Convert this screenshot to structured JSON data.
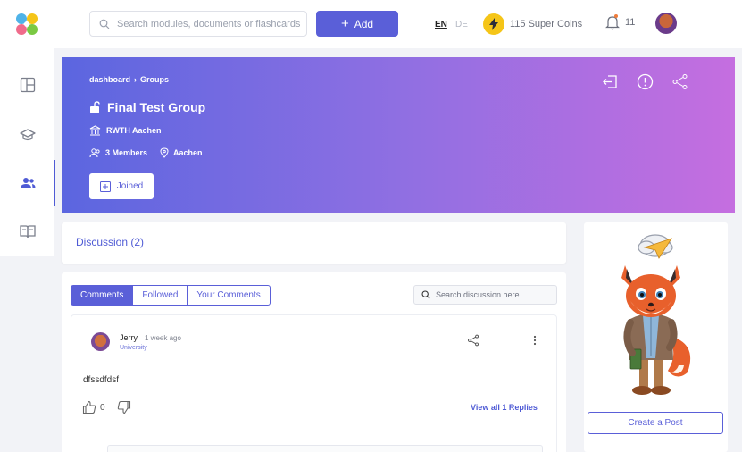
{
  "topbar": {
    "search_placeholder": "Search modules, documents or flashcards",
    "add_label": "Add",
    "lang_en": "EN",
    "lang_de": "DE",
    "coins": "115 Super Coins",
    "notifications": "11"
  },
  "sidebar": {
    "items": [
      {
        "icon": "dashboard-icon"
      },
      {
        "icon": "graduation-cap-icon"
      },
      {
        "icon": "groups-icon",
        "active": true
      },
      {
        "icon": "book-icon"
      }
    ]
  },
  "banner": {
    "breadcrumb_root": "dashboard",
    "breadcrumb_current": "Groups",
    "title": "Final Test Group",
    "university": "RWTH Aachen",
    "members": "3 Members",
    "location": "Aachen",
    "joined_label": "Joined"
  },
  "tabs": {
    "discussion": "Discussion (2)"
  },
  "filters": {
    "comments": "Comments",
    "followed": "Followed",
    "your_comments": "Your Comments",
    "search_placeholder": "Search discussion here"
  },
  "comment": {
    "author": "Jerry",
    "time": "1 week ago",
    "role": "University",
    "text": "dfssdfdsf",
    "likes": "0",
    "replies_link": "View all 1 Replies"
  },
  "right_panel": {
    "create_post_label": "Create a Post"
  },
  "colors": {
    "accent": "#5a5fd8",
    "banner_start": "#5b66e0",
    "banner_end": "#c56ee0",
    "coin": "#f5c518"
  }
}
